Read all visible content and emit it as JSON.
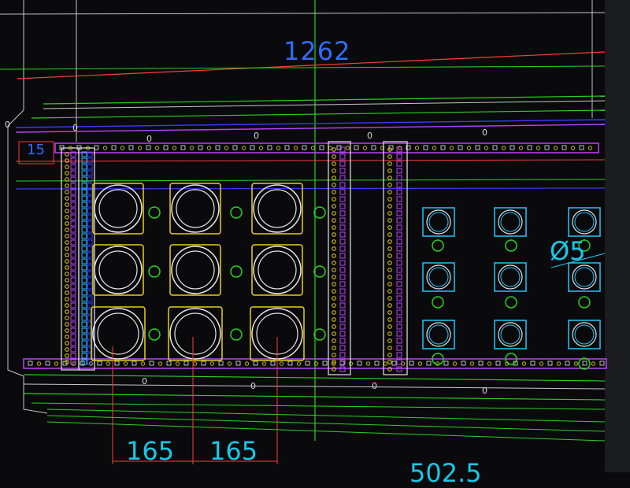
{
  "dimensions": {
    "top_width": "1262",
    "left_small": "15",
    "spacing_a": "165",
    "spacing_b": "165",
    "bottom_partial": "502.5",
    "diameter_partial": "Ø5"
  },
  "zero_marks": [
    "0",
    "0",
    "0",
    "0",
    "0",
    "0",
    "0",
    "0",
    "0",
    "0"
  ],
  "colors": {
    "background": "#0a0a0c",
    "red_line": "#ff3b3b",
    "green_line": "#28d21e",
    "blue_line": "#3a3cff",
    "magenta": "#c040ff",
    "yellow": "#e8d018",
    "cyan": "#1ec8ff",
    "white": "#e6e6e6",
    "dim_blue": "#2f6cff"
  }
}
